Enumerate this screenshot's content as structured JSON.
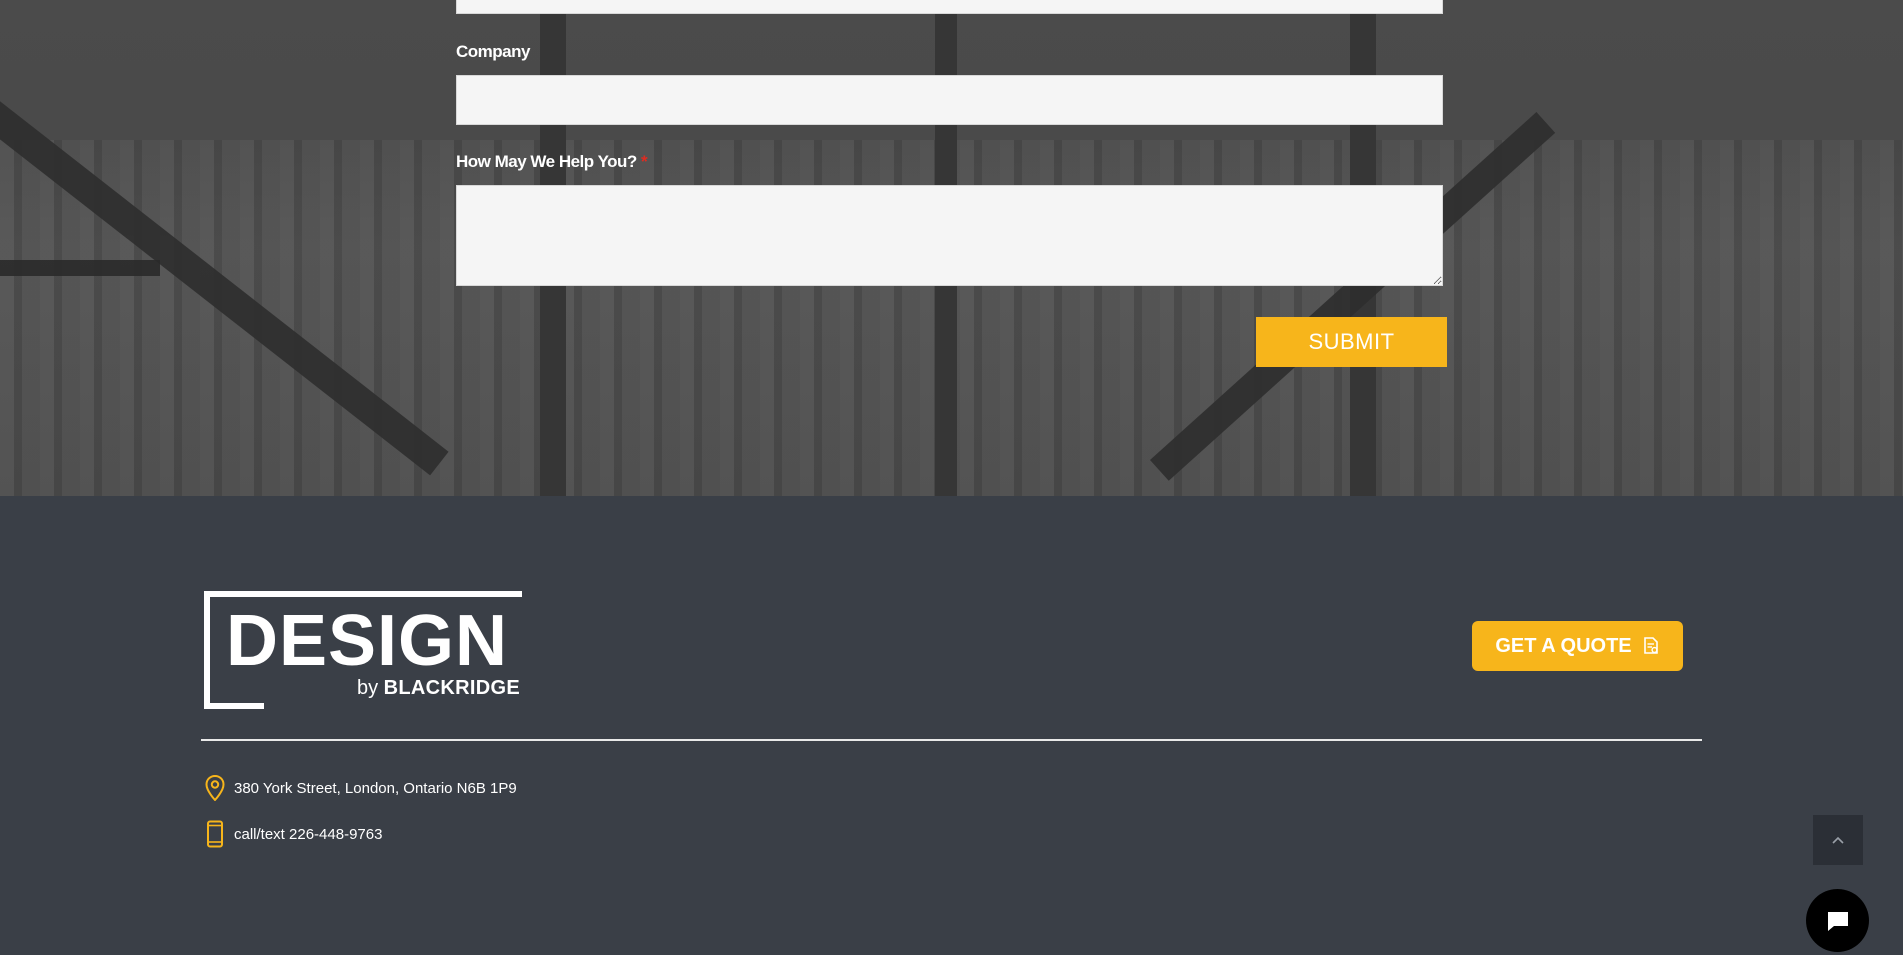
{
  "form": {
    "company_label": "Company",
    "company_value": "",
    "help_label": "How May We Help You?",
    "help_required_marker": "*",
    "help_value": "",
    "submit_label": "SUBMIT"
  },
  "footer": {
    "logo": {
      "wordmark": "DESIGN",
      "by": "by",
      "brand": "BLACKRIDGE"
    },
    "quote_button": {
      "label": "GET A QUOTE",
      "icon": "quote-document-icon"
    },
    "contact": {
      "address": "380 York Street, London, Ontario N6B 1P9",
      "address_icon": "map-pin-icon",
      "phone": "call/text 226-448-9763",
      "phone_icon": "mobile-phone-icon"
    },
    "back_to_top_icon": "chevron-up-icon",
    "chat_icon": "chat-bubble-icon"
  },
  "colors": {
    "accent": "#f7b51b",
    "footer_bg": "#3a3f47",
    "required": "#e02b20"
  }
}
